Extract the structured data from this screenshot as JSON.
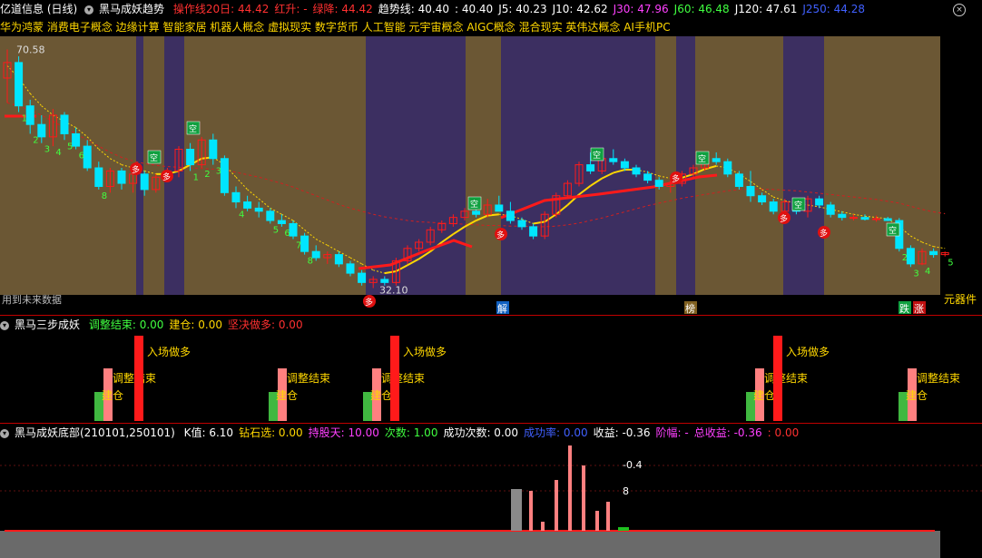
{
  "colors": {
    "bg": "#000000",
    "band_brown": "#6b5734",
    "band_purple": "#3c2f61",
    "up": "#ff1a1a",
    "down": "#00e5ff",
    "yellow": "#ffd700",
    "separator": "#c00000"
  },
  "header": {
    "title": "亿道信息 (日线)",
    "indicator": "黑马成妖趋势",
    "items": [
      {
        "label": "操作线20日: 44.42",
        "color": "#ff3030"
      },
      {
        "label": "红升: -",
        "color": "#ff3030"
      },
      {
        "label": "绿降: 44.42",
        "color": "#ff3030"
      },
      {
        "label": "趋势线: 40.40",
        "color": "#ffffff"
      },
      {
        "label": ": 40.40",
        "color": "#ffffff"
      },
      {
        "label": "J5: 40.23",
        "color": "#ffffff"
      },
      {
        "label": "J10: 42.62",
        "color": "#ffffff"
      },
      {
        "label": "J30: 47.96",
        "color": "#ff40ff"
      },
      {
        "label": "J60: 46.48",
        "color": "#40ff40"
      },
      {
        "label": "J120: 47.61",
        "color": "#ffffff"
      },
      {
        "label": "J250: 44.28",
        "color": "#4060ff"
      }
    ]
  },
  "concepts": "华为鸿蒙 消费电子概念 边缘计算 智能家居 机器人概念 虚拟现实 数字货币 人工智能 元宇宙概念 AIGC概念 混合现实 英伟达概念 AI手机PC",
  "main_chart": {
    "high_label": "70.58",
    "low_label": "32.10",
    "future_label": "用到未来数据",
    "right_label": "元器件",
    "markers": {
      "jie": "解",
      "bang": "榜",
      "die": "跌",
      "zhang": "涨",
      "duo": "多",
      "kong": "空"
    },
    "candles": [
      [
        66.0,
        70.6,
        62.0,
        68.5
      ],
      [
        68.5,
        69.5,
        60.5,
        61.5
      ],
      [
        61.5,
        62.5,
        57.0,
        58.5
      ],
      [
        58.5,
        60.0,
        55.5,
        56.5
      ],
      [
        56.5,
        61.0,
        55.0,
        60.0
      ],
      [
        60.0,
        60.5,
        56.0,
        57.0
      ],
      [
        57.0,
        58.0,
        54.5,
        55.0
      ],
      [
        55.0,
        56.0,
        51.0,
        51.5
      ],
      [
        51.5,
        52.5,
        48.0,
        48.5
      ],
      [
        48.5,
        51.5,
        47.5,
        51.0
      ],
      [
        51.0,
        51.5,
        48.0,
        49.0
      ],
      [
        49.0,
        51.0,
        47.5,
        50.5
      ],
      [
        50.5,
        51.0,
        47.0,
        48.0
      ],
      [
        48.0,
        50.5,
        47.5,
        50.0
      ],
      [
        50.0,
        51.5,
        49.5,
        51.0
      ],
      [
        51.0,
        55.0,
        50.0,
        54.5
      ],
      [
        54.5,
        55.5,
        51.0,
        52.0
      ],
      [
        52.0,
        56.5,
        51.5,
        56.0
      ],
      [
        56.0,
        57.0,
        52.0,
        53.0
      ],
      [
        53.0,
        53.5,
        47.0,
        47.5
      ],
      [
        47.5,
        48.5,
        45.0,
        46.0
      ],
      [
        46.0,
        47.0,
        44.5,
        45.0
      ],
      [
        45.0,
        46.0,
        43.5,
        44.5
      ],
      [
        44.5,
        45.0,
        42.5,
        43.0
      ],
      [
        43.0,
        44.0,
        42.0,
        42.5
      ],
      [
        42.5,
        43.0,
        40.0,
        40.5
      ],
      [
        40.5,
        41.0,
        37.5,
        38.0
      ],
      [
        38.0,
        39.0,
        36.5,
        37.0
      ],
      [
        37.0,
        38.0,
        36.0,
        37.5
      ],
      [
        37.5,
        38.0,
        35.5,
        36.0
      ],
      [
        36.0,
        36.5,
        34.0,
        34.5
      ],
      [
        34.5,
        35.0,
        32.5,
        33.0
      ],
      [
        33.0,
        34.0,
        32.1,
        33.5
      ],
      [
        33.5,
        34.0,
        32.5,
        33.0
      ],
      [
        33.0,
        37.0,
        32.5,
        36.5
      ],
      [
        36.5,
        39.0,
        36.0,
        38.5
      ],
      [
        38.5,
        40.0,
        38.0,
        39.5
      ],
      [
        39.5,
        42.0,
        39.0,
        41.5
      ],
      [
        41.5,
        43.0,
        41.0,
        42.5
      ],
      [
        42.5,
        44.0,
        42.0,
        43.5
      ],
      [
        43.5,
        45.0,
        43.0,
        44.5
      ],
      [
        44.5,
        45.5,
        43.5,
        44.0
      ],
      [
        44.0,
        46.5,
        43.5,
        45.5
      ],
      [
        45.5,
        47.0,
        44.5,
        44.5
      ],
      [
        44.5,
        46.0,
        42.5,
        43.0
      ],
      [
        43.0,
        43.5,
        41.5,
        42.0
      ],
      [
        42.0,
        42.5,
        40.0,
        40.5
      ],
      [
        40.5,
        44.5,
        40.0,
        44.0
      ],
      [
        44.0,
        47.5,
        43.5,
        47.0
      ],
      [
        47.0,
        49.5,
        46.5,
        49.0
      ],
      [
        49.0,
        52.5,
        48.5,
        52.0
      ],
      [
        52.0,
        54.0,
        50.5,
        51.0
      ],
      [
        51.0,
        53.5,
        50.5,
        53.0
      ],
      [
        53.0,
        54.5,
        52.0,
        52.5
      ],
      [
        52.5,
        53.0,
        51.0,
        51.5
      ],
      [
        51.5,
        52.0,
        50.0,
        50.5
      ],
      [
        50.5,
        51.0,
        49.0,
        49.5
      ],
      [
        49.5,
        50.0,
        48.0,
        48.5
      ],
      [
        48.5,
        49.5,
        47.5,
        49.0
      ],
      [
        49.0,
        51.0,
        48.5,
        50.5
      ],
      [
        50.5,
        52.0,
        50.0,
        51.5
      ],
      [
        51.5,
        53.5,
        51.0,
        53.0
      ],
      [
        53.0,
        54.0,
        52.0,
        52.5
      ],
      [
        52.5,
        53.0,
        50.0,
        50.5
      ],
      [
        50.5,
        51.0,
        48.0,
        48.5
      ],
      [
        48.5,
        51.0,
        46.0,
        47.0
      ],
      [
        47.0,
        47.5,
        45.5,
        46.0
      ],
      [
        46.0,
        46.5,
        44.0,
        44.5
      ],
      [
        44.5,
        46.5,
        44.0,
        46.0
      ],
      [
        46.0,
        46.5,
        44.0,
        44.5
      ],
      [
        44.5,
        47.0,
        43.5,
        46.5
      ],
      [
        46.5,
        47.0,
        45.0,
        45.5
      ],
      [
        45.5,
        46.0,
        43.5,
        44.0
      ],
      [
        44.0,
        44.5,
        43.0,
        43.5
      ],
      [
        43.5,
        44.0,
        43.0,
        43.5
      ],
      [
        43.5,
        44.0,
        43.0,
        43.2
      ],
      [
        43.2,
        43.8,
        42.8,
        43.3
      ],
      [
        43.3,
        43.6,
        42.9,
        43.0
      ],
      [
        43.0,
        43.4,
        38.0,
        38.5
      ],
      [
        38.5,
        39.0,
        35.5,
        36.0
      ],
      [
        36.0,
        38.5,
        35.8,
        38.0
      ],
      [
        38.0,
        38.5,
        37.0,
        37.5
      ],
      [
        37.5,
        38.0,
        37.2,
        37.8
      ]
    ],
    "ma20": [
      62.0,
      61.5,
      60.8,
      60.0,
      59.0,
      58.0,
      57.0,
      56.0,
      55.0,
      54.0,
      53.2,
      52.6,
      52.2,
      51.9,
      51.7,
      51.6,
      51.5,
      51.4,
      51.3,
      51.1,
      50.8,
      50.4,
      50.0,
      49.5,
      49.0,
      48.4,
      47.7,
      47.0,
      46.3,
      45.6,
      45.0,
      44.5,
      44.0,
      43.6,
      43.3,
      43.0,
      42.8,
      42.7,
      42.6,
      42.5,
      42.4,
      42.3,
      42.2,
      42.2,
      42.1,
      42.1,
      42.0,
      42.0,
      42.1,
      42.3,
      42.6,
      43.0,
      43.4,
      43.9,
      44.4,
      44.9,
      45.4,
      45.8,
      46.2,
      46.6,
      46.9,
      47.2,
      47.5,
      47.8,
      48.0,
      48.1,
      48.1,
      48.0,
      47.9,
      47.8,
      47.6,
      47.4,
      47.2,
      47.0,
      46.8,
      46.6,
      46.4,
      46.1,
      45.8,
      45.3,
      44.8,
      44.4,
      44.1
    ],
    "trend": [
      68.0,
      66.0,
      63.5,
      61.5,
      60.0,
      59.0,
      58.0,
      56.5,
      54.5,
      53.0,
      52.0,
      51.5,
      51.0,
      50.5,
      50.5,
      51.0,
      52.0,
      53.0,
      53.2,
      52.0,
      50.0,
      48.0,
      46.5,
      45.0,
      44.0,
      43.0,
      41.5,
      40.0,
      39.0,
      38.0,
      37.0,
      36.0,
      35.0,
      34.5,
      34.8,
      35.8,
      36.8,
      38.0,
      39.5,
      40.8,
      42.0,
      43.0,
      43.8,
      44.0,
      43.8,
      43.2,
      42.5,
      42.8,
      44.0,
      45.5,
      47.2,
      48.6,
      49.8,
      50.7,
      51.2,
      51.2,
      50.8,
      50.2,
      49.8,
      49.9,
      50.5,
      51.3,
      51.8,
      51.5,
      50.5,
      49.3,
      48.0,
      46.8,
      46.2,
      45.8,
      45.5,
      45.2,
      44.8,
      44.4,
      44.0,
      43.7,
      43.5,
      43.3,
      42.0,
      40.5,
      39.5,
      38.8,
      38.5
    ]
  },
  "sub1": {
    "title": "黑马三步成妖",
    "items": [
      {
        "label": "调整结束: 0.00",
        "color": "#40ff40"
      },
      {
        "label": "建仓: 0.00",
        "color": "#ffd700"
      },
      {
        "label": "坚决做多: 0.00",
        "color": "#ff3030"
      }
    ],
    "labels": {
      "entry": "入场做多",
      "adjust": "调整结束",
      "build": "建仓"
    }
  },
  "sub2": {
    "title": "黑马成妖底部(210101,250101)",
    "items": [
      {
        "label": "K值: 6.10",
        "color": "#ffffff"
      },
      {
        "label": "钻石选: 0.00",
        "color": "#ffd700"
      },
      {
        "label": "持股天: 10.00",
        "color": "#ff40ff"
      },
      {
        "label": "次数: 1.00",
        "color": "#40ff40"
      },
      {
        "label": "成功次数: 0.00",
        "color": "#ffffff"
      },
      {
        "label": "成功率: 0.00",
        "color": "#4060ff"
      },
      {
        "label": "收益: -0.36",
        "color": "#ffffff"
      },
      {
        "label": "阶幅: -",
        "color": "#ff40ff"
      },
      {
        "label": "总收益: -0.36",
        "color": "#ff40ff"
      },
      {
        "label": ": 0.00",
        "color": "#ff3030"
      }
    ],
    "labels": {
      "v1": "-0.4",
      "v2": "8"
    }
  }
}
